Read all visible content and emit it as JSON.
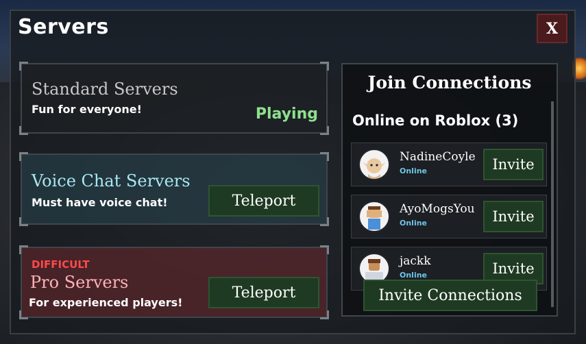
{
  "window": {
    "title": "Servers",
    "close_label": "X"
  },
  "servers": {
    "standard": {
      "title": "Standard Servers",
      "subtitle": "Fun for everyone!",
      "status": "Playing"
    },
    "voice": {
      "title": "Voice Chat Servers",
      "subtitle": "Must have voice chat!",
      "button": "Teleport"
    },
    "pro": {
      "tag": "DIFFICULT",
      "title": "Pro Servers",
      "subtitle": "For experienced players!",
      "button": "Teleport"
    }
  },
  "connections": {
    "title": "Join Connections",
    "online_header": "Online on Roblox (3)",
    "friends": [
      {
        "name": "NadineCoyle",
        "status": "Online",
        "button": "Invite",
        "avatar": "elf-avatar-icon"
      },
      {
        "name": "AyoMogsYou",
        "status": "Online",
        "button": "Invite",
        "avatar": "facepalm-avatar-icon"
      },
      {
        "name": "jackk",
        "status": "Online",
        "button": "Invite",
        "avatar": "brown-hair-avatar-icon"
      }
    ],
    "invite_all": "Invite Connections"
  },
  "colors": {
    "accent_green": "#1f3a22",
    "playing": "#8ee08e",
    "difficult": "#ff4a4a",
    "online": "#6fc6e8"
  }
}
